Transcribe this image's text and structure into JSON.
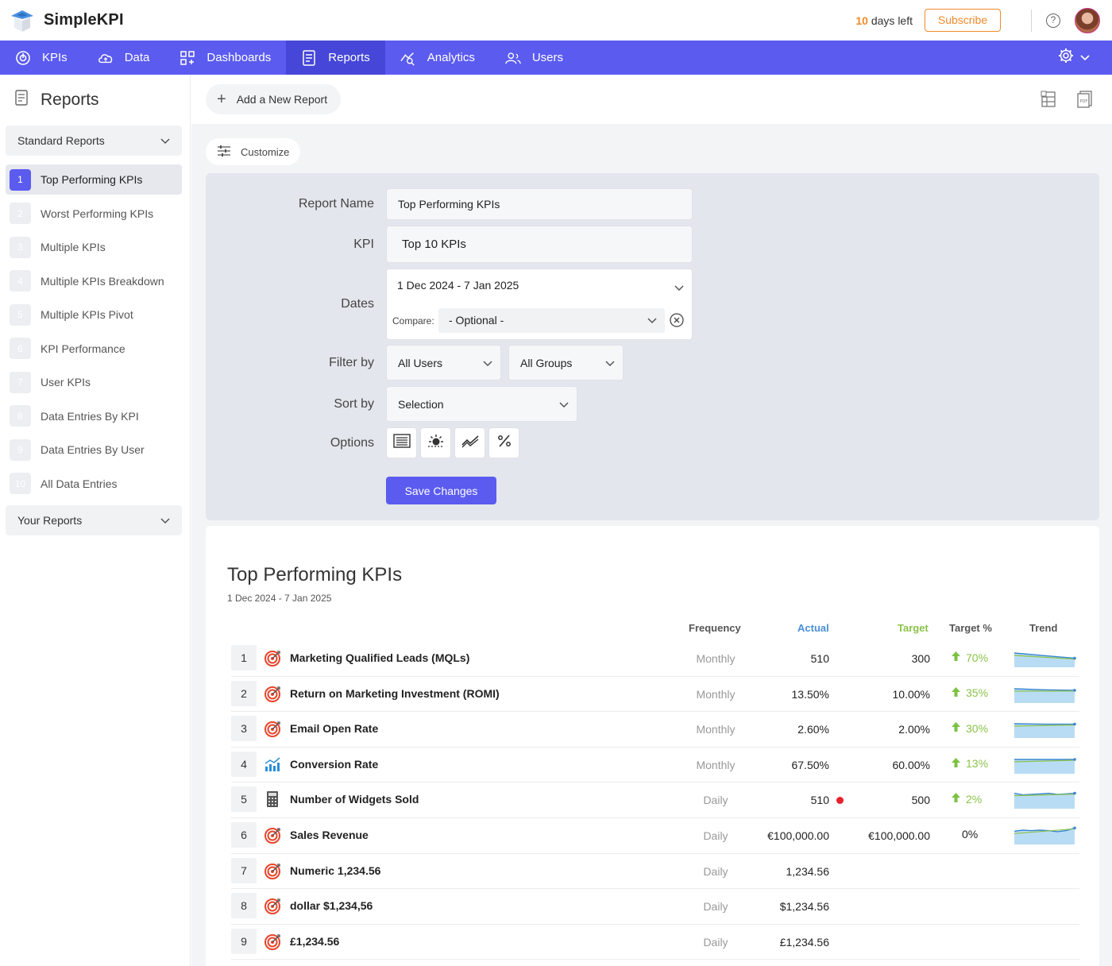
{
  "app": {
    "name": "SimpleKPI"
  },
  "trial": {
    "days_number": "10",
    "days_text": "days left",
    "subscribe_label": "Subscribe"
  },
  "nav": {
    "items": [
      {
        "label": "KPIs",
        "icon": "kpi-gauge-icon"
      },
      {
        "label": "Data",
        "icon": "cloud-upload-icon"
      },
      {
        "label": "Dashboards",
        "icon": "dashboard-grid-icon"
      },
      {
        "label": "Reports",
        "icon": "report-document-icon",
        "active": true
      },
      {
        "label": "Analytics",
        "icon": "analytics-chart-icon"
      },
      {
        "label": "Users",
        "icon": "users-icon"
      }
    ],
    "settings_icon": "gear-icon"
  },
  "sidebar": {
    "title": "Reports",
    "standard_group": "Standard Reports",
    "items": [
      {
        "num": "1",
        "label": "Top Performing KPIs",
        "active": true
      },
      {
        "num": "2",
        "label": "Worst Performing KPIs"
      },
      {
        "num": "3",
        "label": "Multiple KPIs"
      },
      {
        "num": "4",
        "label": "Multiple KPIs Breakdown"
      },
      {
        "num": "5",
        "label": "Multiple KPIs Pivot"
      },
      {
        "num": "6",
        "label": "KPI Performance"
      },
      {
        "num": "7",
        "label": "User KPIs"
      },
      {
        "num": "8",
        "label": "Data Entries By KPI"
      },
      {
        "num": "9",
        "label": "Data Entries By User"
      },
      {
        "num": "10",
        "label": "All Data Entries"
      }
    ],
    "your_group": "Your Reports"
  },
  "toolbar": {
    "add_label": "Add a New Report",
    "customize_label": "Customize"
  },
  "form": {
    "report_name_label": "Report Name",
    "report_name_value": "Top Performing KPIs",
    "kpi_label": "KPI",
    "kpi_value": "Top 10 KPIs",
    "dates_label": "Dates",
    "dates_value": "1 Dec 2024 - 7 Jan 2025",
    "compare_label": "Compare:",
    "compare_value": "- Optional -",
    "filter_label": "Filter by",
    "filter_users": "All Users",
    "filter_groups": "All Groups",
    "sort_label": "Sort by",
    "sort_value": "Selection",
    "options_label": "Options",
    "save_label": "Save Changes"
  },
  "report": {
    "title": "Top Performing KPIs",
    "dates": "1 Dec 2024 - 7 Jan 2025",
    "headers": {
      "frequency": "Frequency",
      "actual": "Actual",
      "target": "Target",
      "target_pct": "Target %",
      "trend": "Trend"
    },
    "rows": [
      {
        "num": "1",
        "icon": "target-icon",
        "name": "Marketing Qualified Leads (MQLs)",
        "frequency": "Monthly",
        "actual": "510",
        "target": "300",
        "pct": "70%",
        "up": true,
        "trend": [
          0.3,
          0.55,
          0.8
        ]
      },
      {
        "num": "2",
        "icon": "target-icon",
        "name": "Return on Marketing Investment (ROMI)",
        "frequency": "Monthly",
        "actual": "13.50%",
        "target": "10.00%",
        "pct": "35%",
        "up": true,
        "trend": [
          0.3,
          0.4,
          0.45
        ]
      },
      {
        "num": "3",
        "icon": "target-icon",
        "name": "Email Open Rate",
        "frequency": "Monthly",
        "actual": "2.60%",
        "target": "2.00%",
        "pct": "30%",
        "up": true,
        "trend": [
          0.3,
          0.35,
          0.35
        ]
      },
      {
        "num": "4",
        "icon": "bar-chart-icon",
        "name": "Conversion Rate",
        "frequency": "Monthly",
        "actual": "67.50%",
        "target": "60.00%",
        "pct": "13%",
        "up": true,
        "trend": [
          0.3,
          0.3,
          0.3
        ]
      },
      {
        "num": "5",
        "icon": "calculator-icon",
        "name": "Number of Widgets Sold",
        "frequency": "Daily",
        "actual": "510",
        "target": "500",
        "pct": "2%",
        "up": true,
        "dot": true,
        "trend": [
          0.2,
          0.35,
          0.3,
          0.25,
          0.2,
          0.3,
          0.25,
          0.2
        ]
      },
      {
        "num": "6",
        "icon": "target-icon",
        "name": "Sales Revenue",
        "frequency": "Daily",
        "actual": "€100,000.00",
        "target": "€100,000.00",
        "pct": "0%",
        "up": false,
        "trend": [
          0.4,
          0.3,
          0.35,
          0.3,
          0.35,
          0.45,
          0.35,
          0.1
        ]
      },
      {
        "num": "7",
        "icon": "target-icon",
        "name": "Numeric 1,234.56",
        "frequency": "Daily",
        "actual": "1,234.56",
        "target": "",
        "pct": ""
      },
      {
        "num": "8",
        "icon": "target-icon",
        "name": "dollar $1,234,56",
        "frequency": "Daily",
        "actual": "$1,234.56",
        "target": "",
        "pct": ""
      },
      {
        "num": "9",
        "icon": "target-icon",
        "name": "£1,234.56",
        "frequency": "Daily",
        "actual": "£1,234.56",
        "target": "",
        "pct": ""
      }
    ]
  },
  "colors": {
    "accent": "#5b5bf0",
    "accent_dark": "#4646d8",
    "trial": "#f08a2c",
    "positive": "#8bc34a",
    "actual_header": "#4a8fd6",
    "alert": "#e8202a"
  }
}
